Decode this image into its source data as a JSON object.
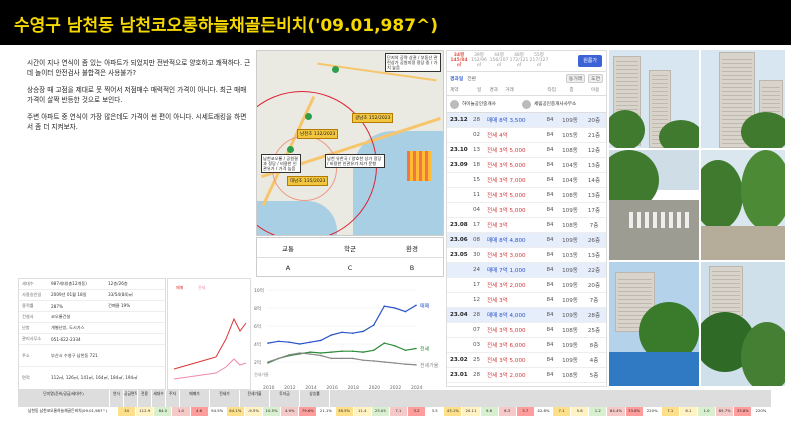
{
  "header": {
    "title": "수영구 남천동 남천코오롱하늘채골든비치('09.01,987^)"
  },
  "description": [
    "시간이 지나 연식이 좀 있는 아파트가 되었지만 전반적으로 양호하고 쾌적하다. 근데 놀이터 안전검사 불합격은 사용불가?",
    "상승장 때 고점을 제대로 못 찍어서 저점매수 매력적인 가격이 아니다. 최근 매매 가격이 살짝 반등한 것으로 보인다.",
    "주변 아파트 중 연식이 가장 많은데도 가격이 썬 편이 아니다. 시세트래킹을 하면서 좀 더 지켜보자."
  ],
  "map": {
    "labels": [
      "단지의 공략 상권 / 부동산 관련상가 공원지정 정당 중 / 가치 높음",
      "남천 유한국 / 양호한 상가 정당 / 비용한 인관유가 지가 문형",
      "남천코오롱 / 공원결과 정당 / 비용한 인관유가 / 가격 높음"
    ],
    "tags": [
      "광남초",
      "남천초",
      "대남초"
    ],
    "tag_values": [
      "152/2023",
      "132/2023",
      "135/2023"
    ]
  },
  "grades": {
    "categories": [
      "교통",
      "학군",
      "환경"
    ],
    "values": [
      "A",
      "C",
      "B"
    ]
  },
  "listing": {
    "tabs": [
      {
        "area": "34평",
        "detail": "145/84㎡"
      },
      {
        "area": "39평",
        "detail": "152/96㎡"
      },
      {
        "area": "44평",
        "detail": "156/107㎡"
      },
      {
        "area": "48평",
        "detail": "172/121㎡"
      },
      {
        "area": "55평",
        "detail": "217/127㎡"
      }
    ],
    "action_button": "원룸가",
    "filter_label": "경과일",
    "filter_mode": "전환",
    "chips": [
      "동거래",
      "도면"
    ],
    "columns": [
      "계약",
      "일",
      "경과",
      "거래",
      "타입",
      "층",
      "이용"
    ],
    "agents": [
      "하이늘공인중개사",
      "세림공인중개사사무소"
    ],
    "rows": [
      {
        "date": "23.12",
        "day": "28",
        "kind": "매매",
        "price": "8억 3,500",
        "type": "84",
        "dong": "109동",
        "floor": "20층",
        "hl": true
      },
      {
        "date": "",
        "day": "02",
        "kind": "전세",
        "price": "4억",
        "type": "84",
        "dong": "105동",
        "floor": "21층",
        "hl": false
      },
      {
        "date": "23.10",
        "day": "13",
        "kind": "전세",
        "price": "3억 5,000",
        "type": "84",
        "dong": "108동",
        "floor": "12층",
        "hl": false
      },
      {
        "date": "23.09",
        "day": "18",
        "kind": "전세",
        "price": "3억 5,000",
        "type": "84",
        "dong": "104동",
        "floor": "13층",
        "hl": false
      },
      {
        "date": "",
        "day": "15",
        "kind": "전세",
        "price": "3억 7,000",
        "type": "84",
        "dong": "104동",
        "floor": "14층",
        "hl": false
      },
      {
        "date": "",
        "day": "11",
        "kind": "전세",
        "price": "3억 5,000",
        "type": "84",
        "dong": "108동",
        "floor": "13층",
        "hl": false
      },
      {
        "date": "",
        "day": "04",
        "kind": "전세",
        "price": "3억 5,000",
        "type": "84",
        "dong": "109동",
        "floor": "17층",
        "hl": false
      },
      {
        "date": "23.08",
        "day": "17",
        "kind": "전세",
        "price": "3억",
        "type": "84",
        "dong": "108동",
        "floor": "7층",
        "hl": false
      },
      {
        "date": "23.06",
        "day": "08",
        "kind": "매매",
        "price": "8억 4,800",
        "type": "84",
        "dong": "109동",
        "floor": "26층",
        "hl": true
      },
      {
        "date": "23.05",
        "day": "30",
        "kind": "전세",
        "price": "3억 3,000",
        "type": "84",
        "dong": "103동",
        "floor": "13층",
        "hl": false
      },
      {
        "date": "",
        "day": "24",
        "kind": "매매",
        "price": "7억 1,000",
        "type": "84",
        "dong": "109동",
        "floor": "22층",
        "hl": true
      },
      {
        "date": "",
        "day": "17",
        "kind": "전세",
        "price": "3억 2,000",
        "type": "84",
        "dong": "109동",
        "floor": "20층",
        "hl": false
      },
      {
        "date": "",
        "day": "12",
        "kind": "전세",
        "price": "3억",
        "type": "84",
        "dong": "109동",
        "floor": "7층",
        "hl": false
      },
      {
        "date": "23.04",
        "day": "28",
        "kind": "매매",
        "price": "8억 4,000",
        "type": "84",
        "dong": "109동",
        "floor": "28층",
        "hl": true
      },
      {
        "date": "",
        "day": "07",
        "kind": "전세",
        "price": "3억 5,000",
        "type": "84",
        "dong": "108동",
        "floor": "25층",
        "hl": false
      },
      {
        "date": "",
        "day": "03",
        "kind": "전세",
        "price": "3억 6,000",
        "type": "84",
        "dong": "109동",
        "floor": "8층",
        "hl": false
      },
      {
        "date": "23.02",
        "day": "25",
        "kind": "전세",
        "price": "3억 5,000",
        "type": "84",
        "dong": "109동",
        "floor": "4층",
        "hl": false
      },
      {
        "date": "23.01",
        "day": "28",
        "kind": "전세",
        "price": "3억 2,000",
        "type": "84",
        "dong": "108동",
        "floor": "5층",
        "hl": false
      }
    ]
  },
  "info": {
    "rows": [
      {
        "k": "세대수",
        "v": "987세대(총12개동)",
        "v2": "12층/26층"
      },
      {
        "k": "사용승인일",
        "v": "2009년 01월 18일",
        "v2": "33/54(84)㎡"
      },
      {
        "k": "용적률",
        "v": "287%",
        "v2": "건폐율 19%"
      },
      {
        "k": "건설사",
        "v": "코오롱건설"
      },
      {
        "k": "난방",
        "v": "개별난방, 도시가스"
      },
      {
        "k": "관리사무소",
        "v": "051-622-2334"
      },
      {
        "k": "주소",
        "v": "부산시 수영구 남천동 721"
      },
      {
        "k": "면적",
        "v": "112㎡, 126㎡, 141㎡, 164㎡, 184㎡, 194㎡"
      }
    ]
  },
  "chart_data": {
    "type": "line",
    "title": "",
    "x": [
      2010,
      2011,
      2012,
      2013,
      2014,
      2015,
      2016,
      2017,
      2018,
      2019,
      2020,
      2021,
      2022,
      2023,
      2024
    ],
    "series": [
      {
        "name": "매매",
        "values": [
          4.1,
          4.3,
          4.2,
          4.0,
          4.2,
          4.4,
          5.0,
          5.3,
          5.2,
          5.4,
          6.1,
          8.2,
          8.0,
          7.6,
          8.3
        ]
      },
      {
        "name": "전세",
        "values": [
          1.9,
          2.4,
          2.7,
          2.9,
          3.1,
          3.0,
          3.1,
          3.2,
          3.2,
          3.1,
          3.3,
          4.1,
          3.8,
          3.3,
          3.5
        ]
      },
      {
        "name": "전세가율",
        "values": [
          0.5,
          0.6,
          0.7,
          0.75,
          0.72,
          0.68,
          0.6,
          0.6,
          0.6,
          0.55,
          0.53,
          0.5,
          0.47,
          0.44,
          0.42
        ]
      }
    ],
    "yticks": [
      "10억",
      "8억",
      "6억",
      "4억",
      "2억"
    ],
    "ylabel2": "전세가율",
    "ylim": [
      0,
      10
    ],
    "grid": true,
    "legend": "right"
  },
  "mini_chart": {
    "series": [
      "매매",
      "전세"
    ]
  },
  "bottom_table": {
    "header": [
      "단지명(준비/공급/세대수)",
      "연식",
      "공급면적",
      "전용",
      "세대수",
      "주차",
      "매매가",
      "전세가",
      "전세가율",
      "투자금",
      "상승률"
    ],
    "row": [
      "남천동 남천코오롱하늘채골든비치(09.01,987^)",
      "34",
      "112.9",
      "84.0",
      "1.0",
      "4.6",
      "94.5%",
      "64.1%",
      "-9.5%",
      "10.5%",
      "4.9%",
      "79.6%",
      "21.1%",
      "38.5%",
      "11.4",
      "23.05",
      "7.1",
      "3.2",
      "3.5",
      "43.1%",
      "20.11",
      "9.6",
      "6.3",
      "3.7",
      "42.8%",
      "7.1",
      "5.8",
      "1.2",
      "84.4%",
      "33.8%",
      "220%",
      "7.1",
      "6.1",
      "1.0",
      "85.7%",
      "33.8%",
      "220%"
    ]
  },
  "colors": {
    "accent": "#f5d800",
    "sale": "#2a54c9",
    "rent": "#2e8b3a",
    "ratio": "#888888"
  }
}
